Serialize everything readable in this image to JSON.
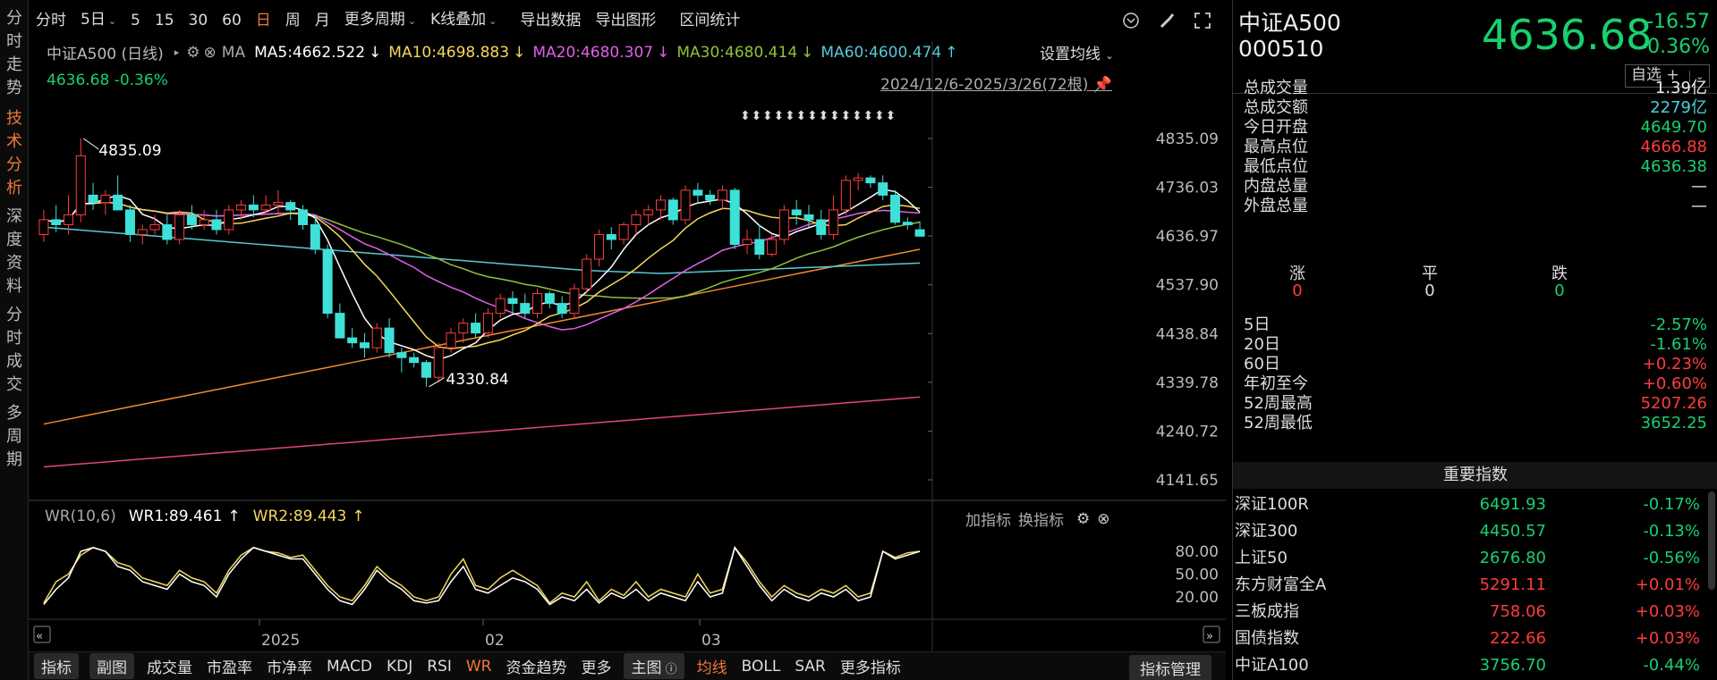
{
  "leftnav": [
    {
      "label": "分时走势"
    },
    {
      "label": "技术分析",
      "active": true
    },
    {
      "label": "深度资料"
    },
    {
      "label": "分时成交"
    },
    {
      "label": "多周期"
    }
  ],
  "toolbar": {
    "tabs": [
      "分时",
      "5日",
      "5",
      "15",
      "30",
      "60",
      "日",
      "周",
      "月",
      "更多周期",
      "K线叠加",
      "导出数据",
      "导出图形",
      "区间统计"
    ],
    "active_tab": "日"
  },
  "legend": {
    "name": "中证A500 (日线)",
    "ma_label": "MA",
    "ma5": "MA5:4662.522",
    "ma10": "MA10:4698.883",
    "ma20": "MA20:4680.307",
    "ma30": "MA30:4680.414",
    "ma60": "MA60:4600.474",
    "set_ma": "设置均线",
    "cur": "4636.68  -0.36%",
    "range": "2024/12/6-2025/3/26(72根)",
    "colors": {
      "ma5": "#ffffff",
      "ma10": "#f5d85a",
      "ma20": "#e060e8",
      "ma30": "#8ec23a",
      "ma60": "#58c8d8",
      "ma120": "#f08a30",
      "ma250": "#e04870"
    }
  },
  "yaxis": [
    "4835.09",
    "4736.03",
    "4636.97",
    "4537.90",
    "4438.84",
    "4339.78",
    "4240.72",
    "4141.65"
  ],
  "annotations": {
    "high": "4835.09",
    "low": "4330.84"
  },
  "xaxis": [
    "2025",
    "02",
    "03"
  ],
  "wr": {
    "title": "WR(10,6)",
    "wr1": "WR1:89.461",
    "wr2": "WR2:89.443",
    "add": "加指标",
    "switch": "换指标",
    "yaxis": [
      "80.00",
      "50.00",
      "20.00"
    ]
  },
  "bottombar": [
    "指标",
    "副图",
    "成交量",
    "市盈率",
    "市净率",
    "MACD",
    "KDJ",
    "RSI",
    "WR",
    "资金趋势",
    "更多",
    "主图",
    "均线",
    "BOLL",
    "SAR",
    "更多指标"
  ],
  "bottombar_active": [
    "WR",
    "均线"
  ],
  "indicator_mgr": "指标管理",
  "quote": {
    "name": "中证A500",
    "code": "000510",
    "price": "4636.68",
    "change": "-16.57",
    "pct": "-0.36%",
    "selfsel": "自选 +"
  },
  "stats": [
    {
      "k": "总成交量",
      "v": "1.39亿",
      "c": "w"
    },
    {
      "k": "总成交额",
      "v": "2279亿",
      "c": "cy"
    },
    {
      "k": "今日开盘",
      "v": "4649.70",
      "c": "g"
    },
    {
      "k": "最高点位",
      "v": "4666.88",
      "c": "r"
    },
    {
      "k": "最低点位",
      "v": "4636.38",
      "c": "g"
    },
    {
      "k": "内盘总量",
      "v": "—",
      "c": "w"
    },
    {
      "k": "外盘总量",
      "v": "—",
      "c": "w"
    }
  ],
  "zpd": {
    "labels": [
      "涨",
      "平",
      "跌"
    ],
    "values": [
      "0",
      "0",
      "0"
    ]
  },
  "periods": [
    {
      "k": "5日",
      "v": "-2.57%",
      "c": "g"
    },
    {
      "k": "20日",
      "v": "-1.61%",
      "c": "g"
    },
    {
      "k": "60日",
      "v": "+0.23%",
      "c": "r"
    },
    {
      "k": "年初至今",
      "v": "+0.60%",
      "c": "r"
    },
    {
      "k": "52周最高",
      "v": "5207.26",
      "c": "r"
    },
    {
      "k": "52周最低",
      "v": "3652.25",
      "c": "g"
    }
  ],
  "index_title": "重要指数",
  "indices": [
    {
      "n": "深证100R",
      "p": "6491.93",
      "c": "-0.17%",
      "pc": "g",
      "cc": "g"
    },
    {
      "n": "深证300",
      "p": "4450.57",
      "c": "-0.13%",
      "pc": "g",
      "cc": "g"
    },
    {
      "n": "上证50",
      "p": "2676.80",
      "c": "-0.56%",
      "pc": "g",
      "cc": "g"
    },
    {
      "n": "东方财富全A",
      "p": "5291.11",
      "c": "+0.01%",
      "pc": "r",
      "cc": "r"
    },
    {
      "n": "三板成指",
      "p": "758.06",
      "c": "+0.03%",
      "pc": "r",
      "cc": "r"
    },
    {
      "n": "国债指数",
      "p": "222.66",
      "c": "+0.03%",
      "pc": "r",
      "cc": "r"
    },
    {
      "n": "中证A100",
      "p": "3756.70",
      "c": "-0.44%",
      "pc": "g",
      "cc": "g"
    }
  ],
  "chart_data": {
    "type": "candlestick",
    "count": 72,
    "ylim": [
      4141.65,
      4835.09
    ],
    "ohlc": [
      [
        4640,
        4690,
        4625,
        4670
      ],
      [
        4670,
        4700,
        4645,
        4660
      ],
      [
        4660,
        4720,
        4640,
        4680
      ],
      [
        4680,
        4835.09,
        4665,
        4800
      ],
      [
        4720,
        4745,
        4690,
        4705
      ],
      [
        4705,
        4730,
        4680,
        4720
      ],
      [
        4720,
        4760,
        4700,
        4690
      ],
      [
        4690,
        4700,
        4625,
        4640
      ],
      [
        4640,
        4660,
        4620,
        4650
      ],
      [
        4650,
        4680,
        4640,
        4660
      ],
      [
        4660,
        4680,
        4620,
        4630
      ],
      [
        4630,
        4690,
        4620,
        4680
      ],
      [
        4680,
        4700,
        4650,
        4660
      ],
      [
        4660,
        4690,
        4650,
        4670
      ],
      [
        4670,
        4690,
        4640,
        4650
      ],
      [
        4650,
        4700,
        4640,
        4690
      ],
      [
        4690,
        4710,
        4670,
        4700
      ],
      [
        4700,
        4720,
        4675,
        4690
      ],
      [
        4690,
        4720,
        4680,
        4700
      ],
      [
        4700,
        4730,
        4680,
        4705
      ],
      [
        4705,
        4710,
        4670,
        4690
      ],
      [
        4690,
        4700,
        4650,
        4660
      ],
      [
        4660,
        4680,
        4600,
        4610
      ],
      [
        4610,
        4620,
        4470,
        4480
      ],
      [
        4480,
        4500,
        4440,
        4430
      ],
      [
        4430,
        4450,
        4410,
        4420
      ],
      [
        4420,
        4440,
        4390,
        4410
      ],
      [
        4410,
        4460,
        4400,
        4450
      ],
      [
        4450,
        4470,
        4390,
        4400
      ],
      [
        4400,
        4410,
        4360,
        4390
      ],
      [
        4390,
        4400,
        4370,
        4380
      ],
      [
        4380,
        4385,
        4330.84,
        4350
      ],
      [
        4350,
        4420,
        4340,
        4410
      ],
      [
        4410,
        4450,
        4400,
        4440
      ],
      [
        4440,
        4470,
        4420,
        4460
      ],
      [
        4460,
        4480,
        4430,
        4440
      ],
      [
        4440,
        4490,
        4430,
        4480
      ],
      [
        4480,
        4520,
        4470,
        4510
      ],
      [
        4510,
        4525,
        4480,
        4500
      ],
      [
        4500,
        4520,
        4470,
        4480
      ],
      [
        4480,
        4530,
        4470,
        4520
      ],
      [
        4520,
        4525,
        4490,
        4500
      ],
      [
        4500,
        4515,
        4470,
        4480
      ],
      [
        4480,
        4540,
        4470,
        4530
      ],
      [
        4530,
        4600,
        4520,
        4590
      ],
      [
        4590,
        4650,
        4575,
        4640
      ],
      [
        4640,
        4655,
        4610,
        4630
      ],
      [
        4630,
        4665,
        4620,
        4660
      ],
      [
        4660,
        4690,
        4640,
        4680
      ],
      [
        4680,
        4700,
        4660,
        4690
      ],
      [
        4690,
        4720,
        4670,
        4710
      ],
      [
        4710,
        4715,
        4660,
        4670
      ],
      [
        4670,
        4740,
        4660,
        4730
      ],
      [
        4730,
        4745,
        4705,
        4720
      ],
      [
        4720,
        4730,
        4700,
        4710
      ],
      [
        4710,
        4740,
        4690,
        4730
      ],
      [
        4730,
        4735,
        4610,
        4620
      ],
      [
        4620,
        4650,
        4600,
        4630
      ],
      [
        4630,
        4660,
        4590,
        4600
      ],
      [
        4600,
        4640,
        4595,
        4630
      ],
      [
        4630,
        4700,
        4620,
        4690
      ],
      [
        4690,
        4710,
        4660,
        4680
      ],
      [
        4680,
        4700,
        4655,
        4670
      ],
      [
        4670,
        4690,
        4630,
        4640
      ],
      [
        4640,
        4720,
        4630,
        4690
      ],
      [
        4690,
        4760,
        4680,
        4750
      ],
      [
        4750,
        4765,
        4730,
        4755
      ],
      [
        4755,
        4760,
        4735,
        4745
      ],
      [
        4745,
        4760,
        4710,
        4720
      ],
      [
        4720,
        4730,
        4660,
        4665
      ],
      [
        4665,
        4675,
        4650,
        4660
      ],
      [
        4649.7,
        4666.88,
        4636.38,
        4636.68
      ]
    ],
    "wr1": [
      10,
      30,
      45,
      80,
      85,
      80,
      60,
      55,
      40,
      35,
      30,
      50,
      40,
      35,
      20,
      50,
      70,
      85,
      80,
      75,
      70,
      70,
      50,
      30,
      15,
      10,
      30,
      55,
      40,
      30,
      15,
      12,
      15,
      40,
      60,
      30,
      25,
      35,
      45,
      40,
      30,
      10,
      20,
      15,
      30,
      12,
      25,
      18,
      30,
      15,
      25,
      20,
      15,
      40,
      20,
      25,
      85,
      60,
      35,
      15,
      30,
      20,
      15,
      25,
      20,
      30,
      15,
      20,
      80,
      70,
      75,
      80
    ],
    "wr2": [
      12,
      40,
      50,
      75,
      85,
      80,
      65,
      60,
      45,
      40,
      35,
      55,
      45,
      40,
      25,
      55,
      75,
      85,
      80,
      78,
      72,
      75,
      55,
      35,
      20,
      15,
      35,
      60,
      45,
      35,
      20,
      15,
      20,
      50,
      70,
      35,
      30,
      45,
      55,
      45,
      35,
      12,
      25,
      20,
      40,
      15,
      30,
      22,
      40,
      20,
      30,
      25,
      20,
      50,
      25,
      30,
      85,
      65,
      40,
      20,
      35,
      25,
      20,
      30,
      25,
      35,
      20,
      25,
      80,
      72,
      78,
      80
    ],
    "ma60": [
      4655,
      4653,
      4651,
      4649,
      4647,
      4645,
      4643,
      4641,
      4639,
      4637,
      4635,
      4633,
      4631,
      4629,
      4627,
      4625,
      4623,
      4621,
      4619,
      4617,
      4615,
      4613,
      4611,
      4609,
      4607,
      4605,
      4603,
      4601,
      4599,
      4597,
      4595,
      4593,
      4591,
      4589,
      4587,
      4585,
      4583,
      4581,
      4579,
      4577,
      4575,
      4573,
      4571,
      4569,
      4567,
      4566,
      4565,
      4564,
      4563,
      4562,
      4561,
      4562,
      4563,
      4564,
      4565,
      4566,
      4567,
      4568,
      4569,
      4570,
      4571,
      4572,
      4573,
      4574,
      4575,
      4576,
      4577,
      4578,
      4579,
      4580,
      4581,
      4582
    ],
    "ma120": [
      4255,
      4260,
      4265,
      4270,
      4275,
      4280,
      4285,
      4290,
      4295,
      4300,
      4305,
      4310,
      4315,
      4320,
      4325,
      4330,
      4335,
      4340,
      4345,
      4350,
      4355,
      4360,
      4365,
      4370,
      4375,
      4380,
      4385,
      4390,
      4395,
      4400,
      4405,
      4410,
      4415,
      4420,
      4425,
      4430,
      4435,
      4440,
      4445,
      4450,
      4455,
      4460,
      4465,
      4470,
      4475,
      4480,
      4485,
      4490,
      4495,
      4500,
      4505,
      4510,
      4515,
      4520,
      4525,
      4530,
      4535,
      4540,
      4545,
      4550,
      4555,
      4560,
      4565,
      4570,
      4575,
      4580,
      4585,
      4590,
      4595,
      4600,
      4605,
      4610
    ],
    "ma250": [
      4168,
      4170,
      4172,
      4174,
      4176,
      4178,
      4180,
      4182,
      4184,
      4186,
      4188,
      4190,
      4192,
      4194,
      4196,
      4198,
      4200,
      4202,
      4204,
      4206,
      4208,
      4210,
      4212,
      4214,
      4216,
      4218,
      4220,
      4222,
      4224,
      4226,
      4228,
      4230,
      4232,
      4234,
      4236,
      4238,
      4240,
      4242,
      4244,
      4246,
      4248,
      4250,
      4252,
      4254,
      4256,
      4258,
      4260,
      4262,
      4264,
      4266,
      4268,
      4270,
      4272,
      4274,
      4276,
      4278,
      4280,
      4282,
      4284,
      4286,
      4288,
      4290,
      4292,
      4294,
      4296,
      4298,
      4300,
      4302,
      4304,
      4306,
      4308,
      4310
    ]
  }
}
